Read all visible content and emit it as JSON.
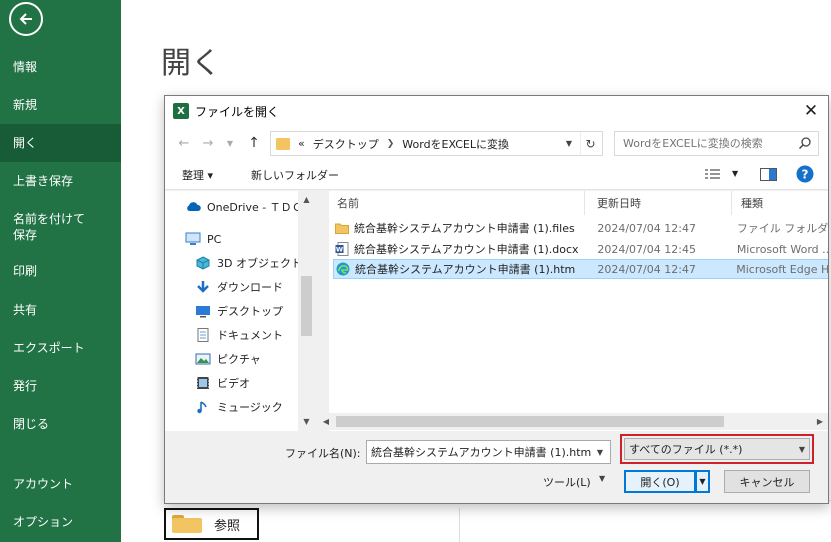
{
  "backstage": {
    "items": [
      {
        "label": "情報"
      },
      {
        "label": "新規"
      },
      {
        "label": "開く"
      },
      {
        "label": "上書き保存"
      },
      {
        "label": "名前を付けて"
      },
      {
        "label": "保存"
      },
      {
        "label": "印刷"
      },
      {
        "label": "共有"
      },
      {
        "label": "エクスポート"
      },
      {
        "label": "発行"
      },
      {
        "label": "閉じる"
      },
      {
        "label": "アカウント"
      },
      {
        "label": "オプション"
      }
    ]
  },
  "main": {
    "title": "開く",
    "browse_label": "参照"
  },
  "dialog": {
    "app_icon": "X",
    "title": "ファイルを開く",
    "close": "✕",
    "breadcrumb": [
      "«",
      "デスクトップ",
      "WordをEXCELに変換"
    ],
    "search_placeholder": "WordをEXCELに変換の検索",
    "toolbar": {
      "organize": "整理 ▾",
      "new_folder": "新しいフォルダー"
    },
    "tree": [
      {
        "label": "OneDrive - ＴＤＣ",
        "icon": "cloud-icon"
      },
      {
        "label": "PC",
        "icon": "pc-icon"
      },
      {
        "label": "3D オブジェクト",
        "icon": "cube-icon"
      },
      {
        "label": "ダウンロード",
        "icon": "download-icon"
      },
      {
        "label": "デスクトップ",
        "icon": "desktop-icon"
      },
      {
        "label": "ドキュメント",
        "icon": "document-icon"
      },
      {
        "label": "ピクチャ",
        "icon": "picture-icon"
      },
      {
        "label": "ビデオ",
        "icon": "video-icon"
      },
      {
        "label": "ミュージック",
        "icon": "music-icon"
      }
    ],
    "columns": {
      "name": "名前",
      "date": "更新日時",
      "type": "種類"
    },
    "files": [
      {
        "name": "統合基幹システムアカウント申請書 (1).files",
        "date": "2024/07/04 12:47",
        "type": "ファイル フォルダー",
        "icon": "folder-icon"
      },
      {
        "name": "統合基幹システムアカウント申請書 (1).docx",
        "date": "2024/07/04 12:45",
        "type": "Microsoft Word ...",
        "icon": "word-icon"
      },
      {
        "name": "統合基幹システムアカウント申請書 (1).htm",
        "date": "2024/07/04 12:47",
        "type": "Microsoft Edge H",
        "icon": "edge-icon",
        "selected": true
      }
    ],
    "filename_label": "ファイル名(N):",
    "filename_value": "統合基幹システムアカウント申請書 (1).htm",
    "filter": "すべてのファイル (*.*)",
    "tools": "ツール(L)",
    "open": "開く(O)",
    "cancel": "キャンセル"
  },
  "colors": {
    "excel_green": "#217346",
    "selected_green": "#185c37",
    "highlight_red": "#d0202a",
    "select_blue": "#cce8ff"
  }
}
